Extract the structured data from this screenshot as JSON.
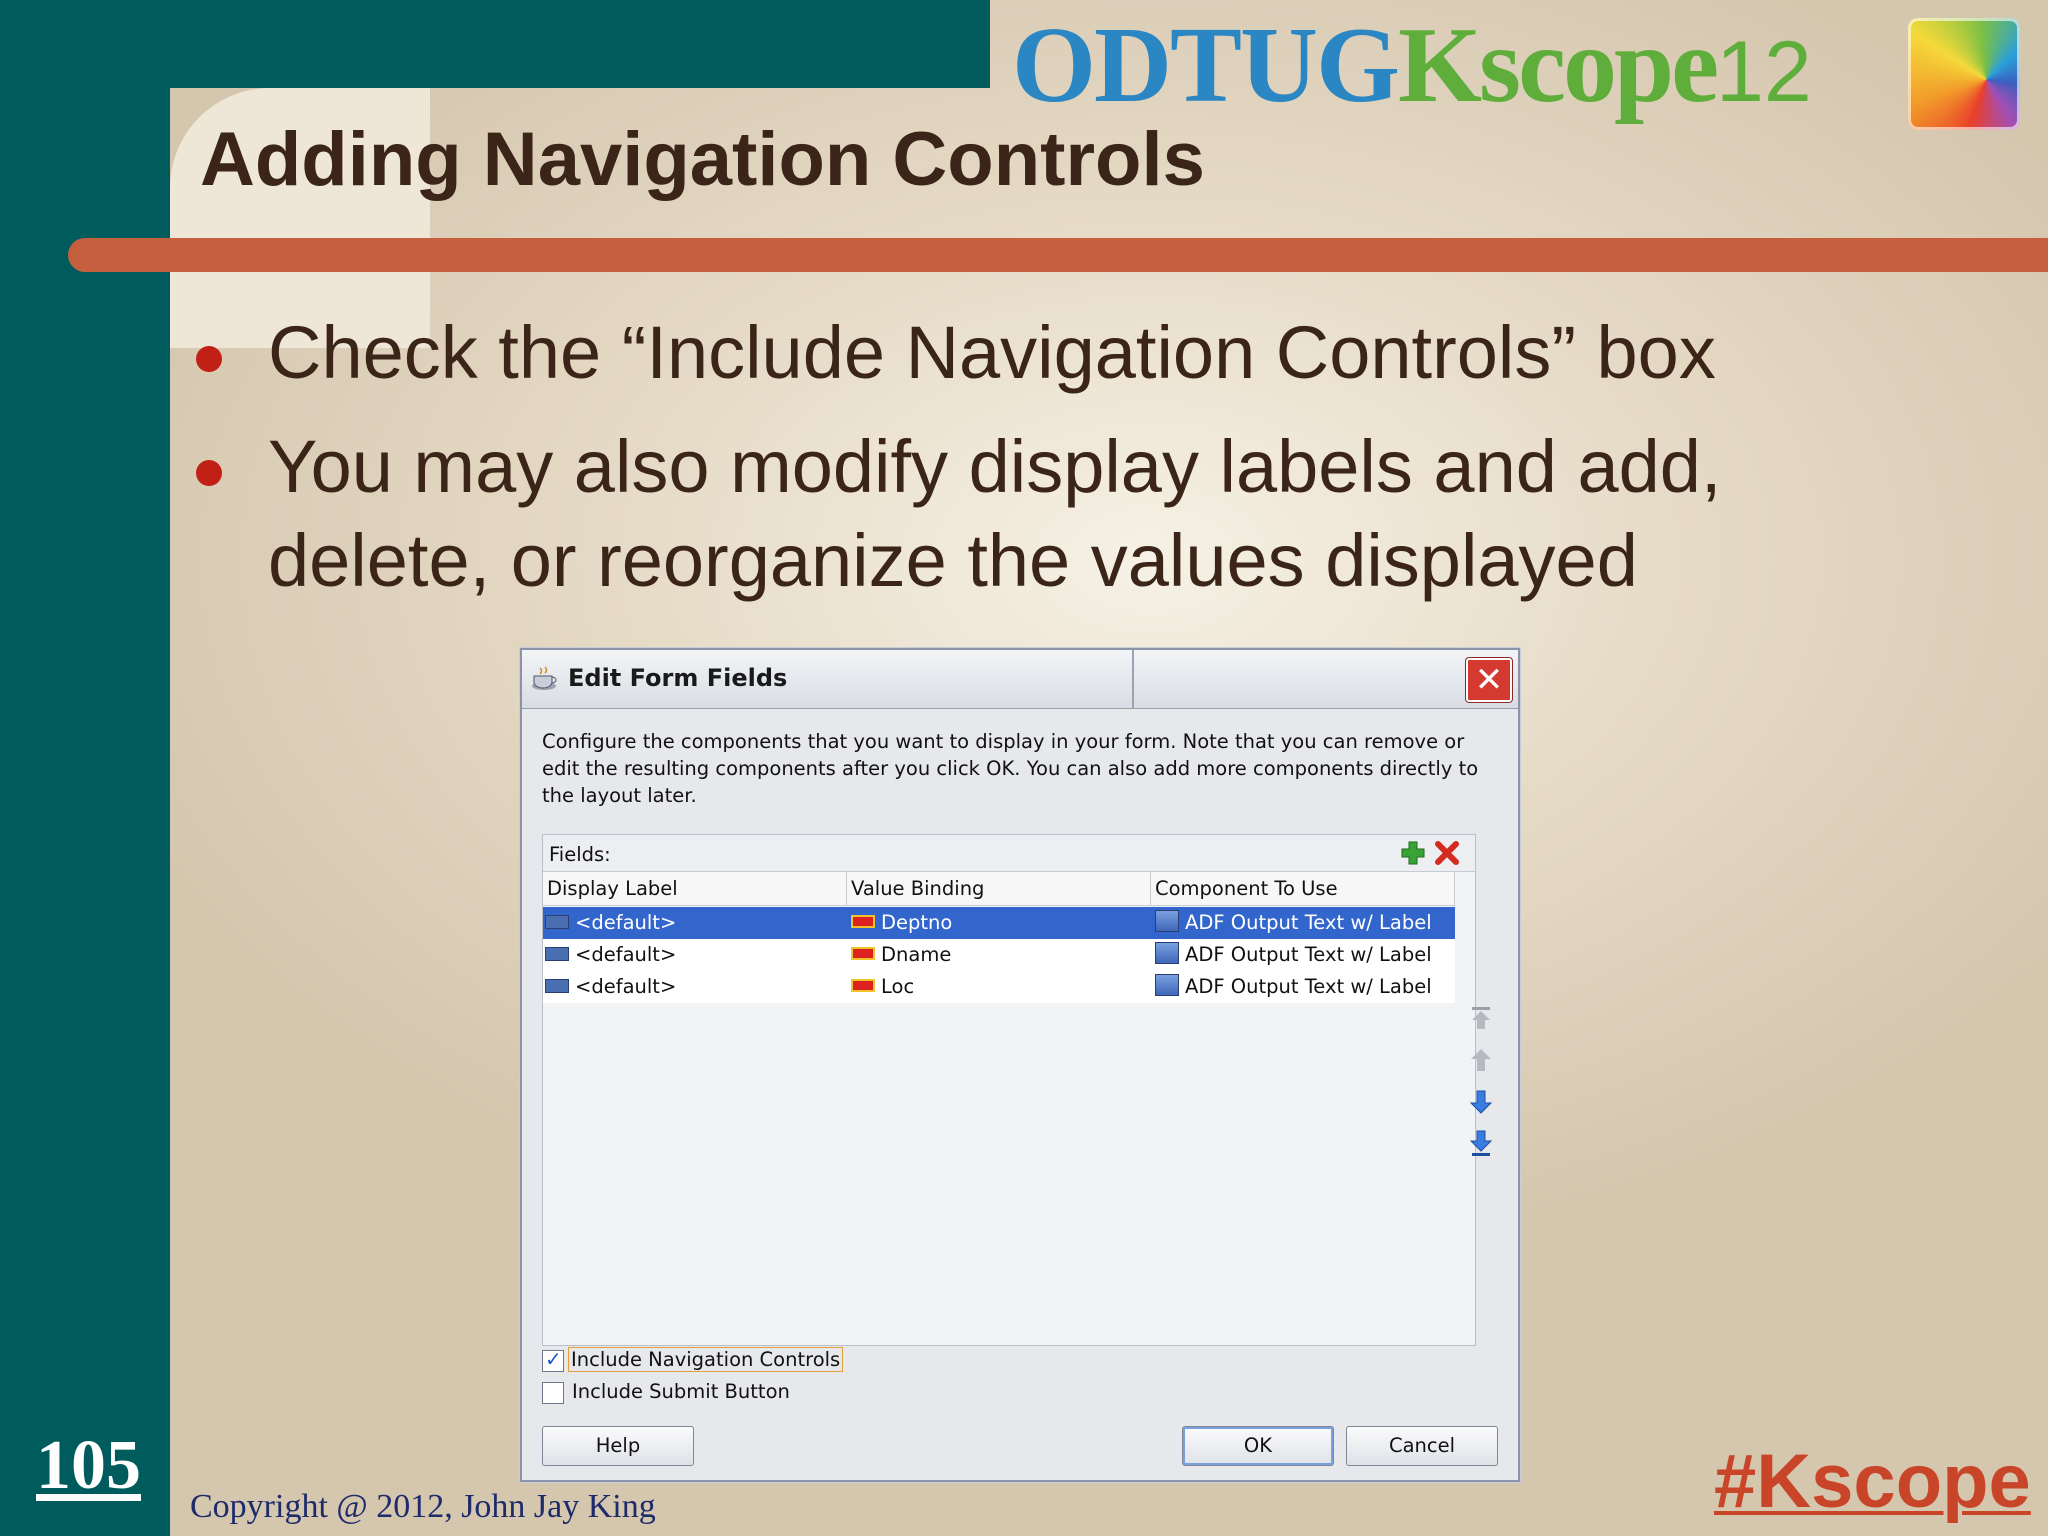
{
  "slide": {
    "title": "Adding Navigation Controls",
    "bullets": [
      {
        "lines": [
          "Check the “Include Navigation Controls” box"
        ]
      },
      {
        "lines": [
          "You may also modify display labels and add,",
          "delete, or reorganize the values displayed"
        ]
      }
    ],
    "logo": {
      "odtug": "ODTUG",
      "kscope": "Kscope",
      "year": "12"
    },
    "page_number": "105",
    "copyright": "Copyright @ 2012, John Jay King",
    "hashtag": "#Kscope",
    "colors": {
      "teal": "#005c5c",
      "rule": "#c65f3e",
      "title": "#3b2418",
      "bullet": "#c02015",
      "hashtag": "#c9452a"
    }
  },
  "dialog": {
    "title": "Edit Form Fields",
    "description": "Configure the components that you want to display in your form.  Note that you can remove or edit the resulting components after you click OK.  You can also add more components directly to the layout later.",
    "fields_label": "Fields:",
    "columns": [
      "Display Label",
      "Value Binding",
      "Component To Use"
    ],
    "rows": [
      {
        "label": "<default>",
        "binding": "Deptno",
        "component": "ADF Output Text w/ Label",
        "selected": true
      },
      {
        "label": "<default>",
        "binding": "Dname",
        "component": "ADF Output Text w/ Label",
        "selected": false
      },
      {
        "label": "<default>",
        "binding": "Loc",
        "component": "ADF Output Text w/ Label",
        "selected": false
      }
    ],
    "checkboxes": [
      {
        "label": "Include Navigation Controls",
        "checked": true
      },
      {
        "label": "Include Submit Button",
        "checked": false
      }
    ],
    "buttons": {
      "help": "Help",
      "ok": "OK",
      "cancel": "Cancel"
    },
    "icons": {
      "close": "close-icon",
      "add": "add-icon",
      "delete": "delete-icon",
      "move": [
        "move-top-icon",
        "move-up-icon",
        "move-down-icon",
        "move-bottom-icon"
      ]
    }
  }
}
